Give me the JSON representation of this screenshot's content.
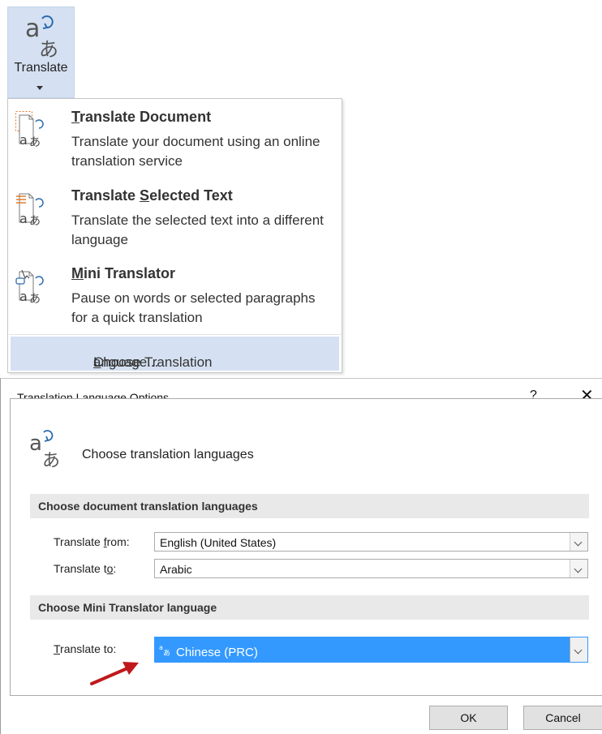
{
  "ribbon": {
    "translate_label": "Translate",
    "icon": "translate-icon"
  },
  "menu": {
    "items": [
      {
        "title_pre": "",
        "title_key": "T",
        "title_post": "ranslate Document",
        "description": "Translate your document using an online translation service",
        "icon": "translate-document-icon"
      },
      {
        "title_pre": "Translate ",
        "title_key": "S",
        "title_post": "elected Text",
        "description": "Translate the selected text into a different language",
        "icon": "translate-selection-icon"
      },
      {
        "title_pre": "",
        "title_key": "M",
        "title_post": "ini Translator",
        "description": "Pause on words or selected paragraphs for a quick translation",
        "icon": "mini-translator-icon"
      }
    ],
    "footer": {
      "pre": "Choose Translation ",
      "key": "L",
      "post": "anguage..."
    }
  },
  "dialog": {
    "title": "Translation Language Options",
    "help": "?",
    "close": "✕",
    "header_text": "Choose translation languages",
    "section_document": "Choose document translation languages",
    "from_label_pre": "Translate ",
    "from_label_key": "f",
    "from_label_post": "rom:",
    "from_value": "English (United States)",
    "to_label_pre": "Translate t",
    "to_label_key": "o",
    "to_label_post": ":",
    "to_value": "Arabic",
    "section_mini": "Choose Mini Translator language",
    "mini_label_key": "T",
    "mini_label_post": "ranslate to:",
    "mini_value": "Chinese (PRC)",
    "ok_label": "OK",
    "cancel_label": "Cancel"
  },
  "colors": {
    "ribbon_highlight": "#d5e1f2",
    "selection_blue": "#3399ff",
    "accent_blue": "#2b6cb0",
    "arrow_red": "#c0191c"
  }
}
